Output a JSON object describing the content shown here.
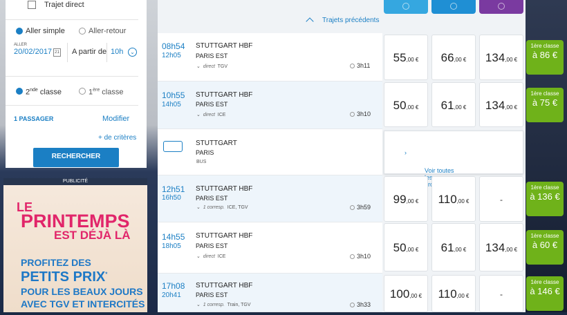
{
  "search": {
    "direct_label": "Trajet direct",
    "aller_simple": "Aller simple",
    "aller_retour": "Aller-retour",
    "aller_caption": "ALLER",
    "date": "20/02/2017",
    "cal_day": "21",
    "a_partir": "A partir de",
    "hour": "10h",
    "classe2_pre": "2",
    "classe2_sup": "nde",
    "classe2_post": " classe",
    "classe1_pre": "1",
    "classe1_sup": "ère",
    "classe1_post": " classe",
    "passengers": "1 PASSAGER",
    "modify": "Modifier",
    "criteria": "+ de critères",
    "search_button": "RECHERCHER"
  },
  "ad": {
    "header": "PUBLICITÉ",
    "le": "LE",
    "printemps": "PRINTEMPS",
    "deja": "EST DÉJÀ LÀ",
    "l1": "PROFITEZ DES",
    "l2": "PETITS PRIX",
    "l2_mark": "*",
    "l3": "POUR LES BEAUX JOURS",
    "l4": "AVEC TGV ET INTERCITÉS"
  },
  "results": {
    "previous": "Trajets précédents",
    "tab_colors": [
      "#35a7e0",
      "#1f8fd4",
      "#7a3aa0"
    ],
    "see_all": "Voir toutes les propositions",
    "rows": [
      {
        "dep": "08h54",
        "arr": "12h05",
        "from": "STUTTGART HBF",
        "to": "PARIS EST",
        "info": "direct",
        "train": "TGV",
        "dur": "3h11",
        "p1": "55",
        "p2": "66",
        "p3": "134",
        "g_class": "1ère classe",
        "g_price": "à 86 €"
      },
      {
        "dep": "10h55",
        "arr": "14h05",
        "from": "STUTTGART HBF",
        "to": "PARIS EST",
        "info": "direct",
        "train": "ICE",
        "dur": "3h10",
        "p1": "50",
        "p2": "61",
        "p3": "134",
        "g_class": "1ère classe",
        "g_price": "à 75 €"
      },
      {
        "from": "STUTTGART",
        "to": "PARIS",
        "mode": "BUS"
      },
      {
        "dep": "12h51",
        "arr": "16h50",
        "from": "STUTTGART HBF",
        "to": "PARIS EST",
        "info": "1 corresp.",
        "train": "ICE, TGV",
        "dur": "3h59",
        "p1": "99",
        "p2": "110",
        "p3": "-",
        "g_class": "1ère classe",
        "g_price": "à 136 €"
      },
      {
        "dep": "14h55",
        "arr": "18h05",
        "from": "STUTTGART HBF",
        "to": "PARIS EST",
        "info": "direct",
        "train": "ICE",
        "dur": "3h10",
        "p1": "50",
        "p2": "61",
        "p3": "134",
        "g_class": "1ère classe",
        "g_price": "à 60 €"
      },
      {
        "dep": "17h08",
        "arr": "20h41",
        "from": "STUTTGART HBF",
        "to": "PARIS EST",
        "info": "1 corresp.",
        "train": "Train, TGV",
        "dur": "3h33",
        "p1": "100",
        "p2": "110",
        "p3": "-",
        "g_class": "1ère classe",
        "g_price": "à 146 €"
      }
    ],
    "price_suffix": ",00 €"
  }
}
